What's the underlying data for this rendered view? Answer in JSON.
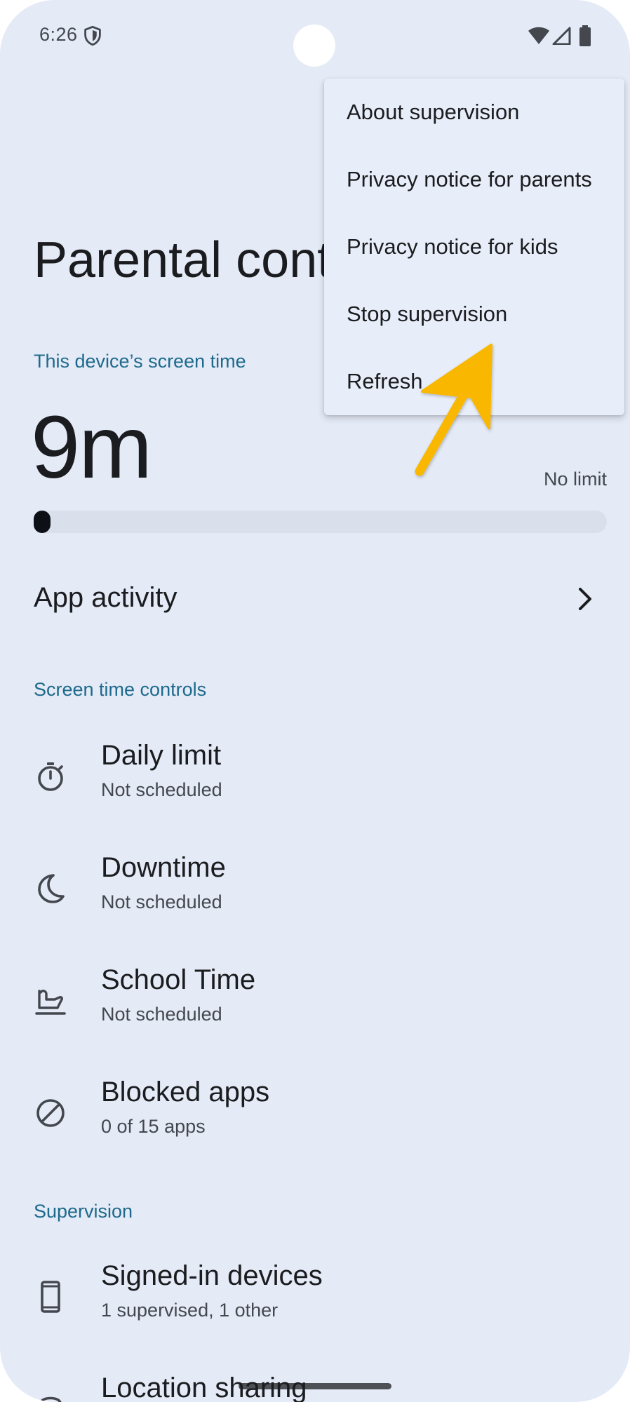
{
  "status_bar": {
    "time": "6:26",
    "icons": [
      "shield-icon",
      "wifi-icon",
      "signal-icon",
      "battery-icon"
    ]
  },
  "page": {
    "title": "Parental cont"
  },
  "screen_time": {
    "section_label": "This device’s screen time",
    "value": "9m",
    "limit_text": "No limit",
    "progress_fraction": 0.02
  },
  "app_activity": {
    "label": "App activity",
    "icon": "chevron-right-icon"
  },
  "screen_time_controls": {
    "section_label": "Screen time controls",
    "items": [
      {
        "title": "Daily limit",
        "subtitle": "Not scheduled",
        "icon": "timer-icon"
      },
      {
        "title": "Downtime",
        "subtitle": "Not scheduled",
        "icon": "moon-icon"
      },
      {
        "title": "School Time",
        "subtitle": "Not scheduled",
        "icon": "school-desk-icon"
      },
      {
        "title": "Blocked apps",
        "subtitle": "0 of 15 apps",
        "icon": "block-icon"
      }
    ]
  },
  "supervision": {
    "section_label": "Supervision",
    "items": [
      {
        "title": "Signed-in devices",
        "subtitle": "1 supervised, 1 other",
        "icon": "phone-icon"
      },
      {
        "title": "Location sharing",
        "subtitle": "",
        "icon": "location-icon"
      }
    ]
  },
  "overflow_menu": {
    "items": [
      {
        "label": "About supervision"
      },
      {
        "label": "Privacy notice for parents"
      },
      {
        "label": "Privacy notice for kids"
      },
      {
        "label": "Stop supervision"
      },
      {
        "label": "Refresh"
      }
    ]
  },
  "colors": {
    "background": "#e4eaf6",
    "accent": "#1d6a8c",
    "menu_background": "#e8eef9",
    "annotation_arrow": "#f9b700",
    "progress_fill": "#0d1117",
    "progress_track": "#d9e0ec"
  }
}
